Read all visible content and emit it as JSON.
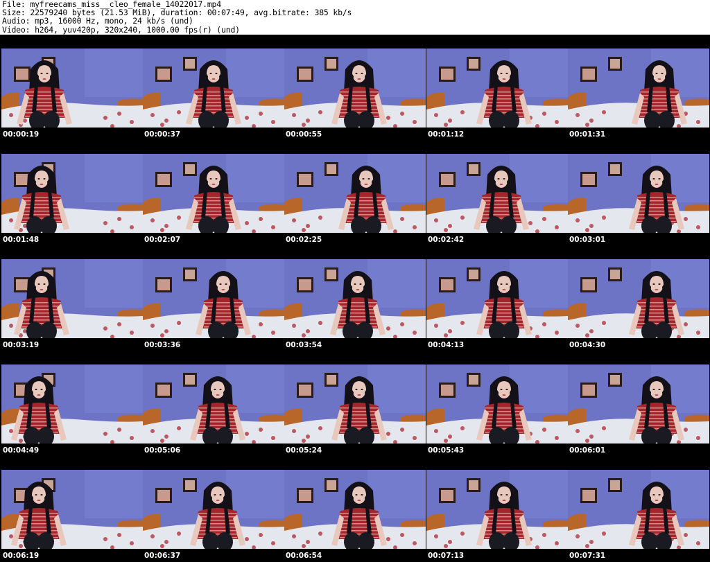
{
  "header": {
    "file_line": "File: myfreecams_miss__cleo_female_14022017.mp4",
    "size_line": "Size: 22579240 bytes (21.53 MiB), duration: 00:07:49, avg.bitrate: 385 kb/s",
    "audio_line": "Audio: mp3, 16000 Hz, mono, 24 kb/s (und)",
    "video_line": "Video: h264, yuv420p, 320x240, 1000.00 fps(r) (und)"
  },
  "thumbnails": [
    {
      "timestamp": "00:00:19"
    },
    {
      "timestamp": "00:00:37"
    },
    {
      "timestamp": "00:00:55"
    },
    {
      "timestamp": "00:01:12"
    },
    {
      "timestamp": "00:01:31"
    },
    {
      "timestamp": "00:01:48"
    },
    {
      "timestamp": "00:02:07"
    },
    {
      "timestamp": "00:02:25"
    },
    {
      "timestamp": "00:02:42"
    },
    {
      "timestamp": "00:03:01"
    },
    {
      "timestamp": "00:03:19"
    },
    {
      "timestamp": "00:03:36"
    },
    {
      "timestamp": "00:03:54"
    },
    {
      "timestamp": "00:04:13"
    },
    {
      "timestamp": "00:04:30"
    },
    {
      "timestamp": "00:04:49"
    },
    {
      "timestamp": "00:05:06"
    },
    {
      "timestamp": "00:05:24"
    },
    {
      "timestamp": "00:05:43"
    },
    {
      "timestamp": "00:06:01"
    },
    {
      "timestamp": "00:06:19"
    },
    {
      "timestamp": "00:06:37"
    },
    {
      "timestamp": "00:06:54"
    },
    {
      "timestamp": "00:07:13"
    },
    {
      "timestamp": "00:07:31"
    }
  ],
  "colors": {
    "sheet_background": "#000000",
    "header_background": "#ffffff",
    "wall": "#6d74c6",
    "bedding": "#e4e8ee",
    "headboard": "#b8662a",
    "hair": "#141018",
    "shirt": "#a5262a",
    "skin": "#e8c8bc",
    "timestamp_text": "#ffffff"
  }
}
